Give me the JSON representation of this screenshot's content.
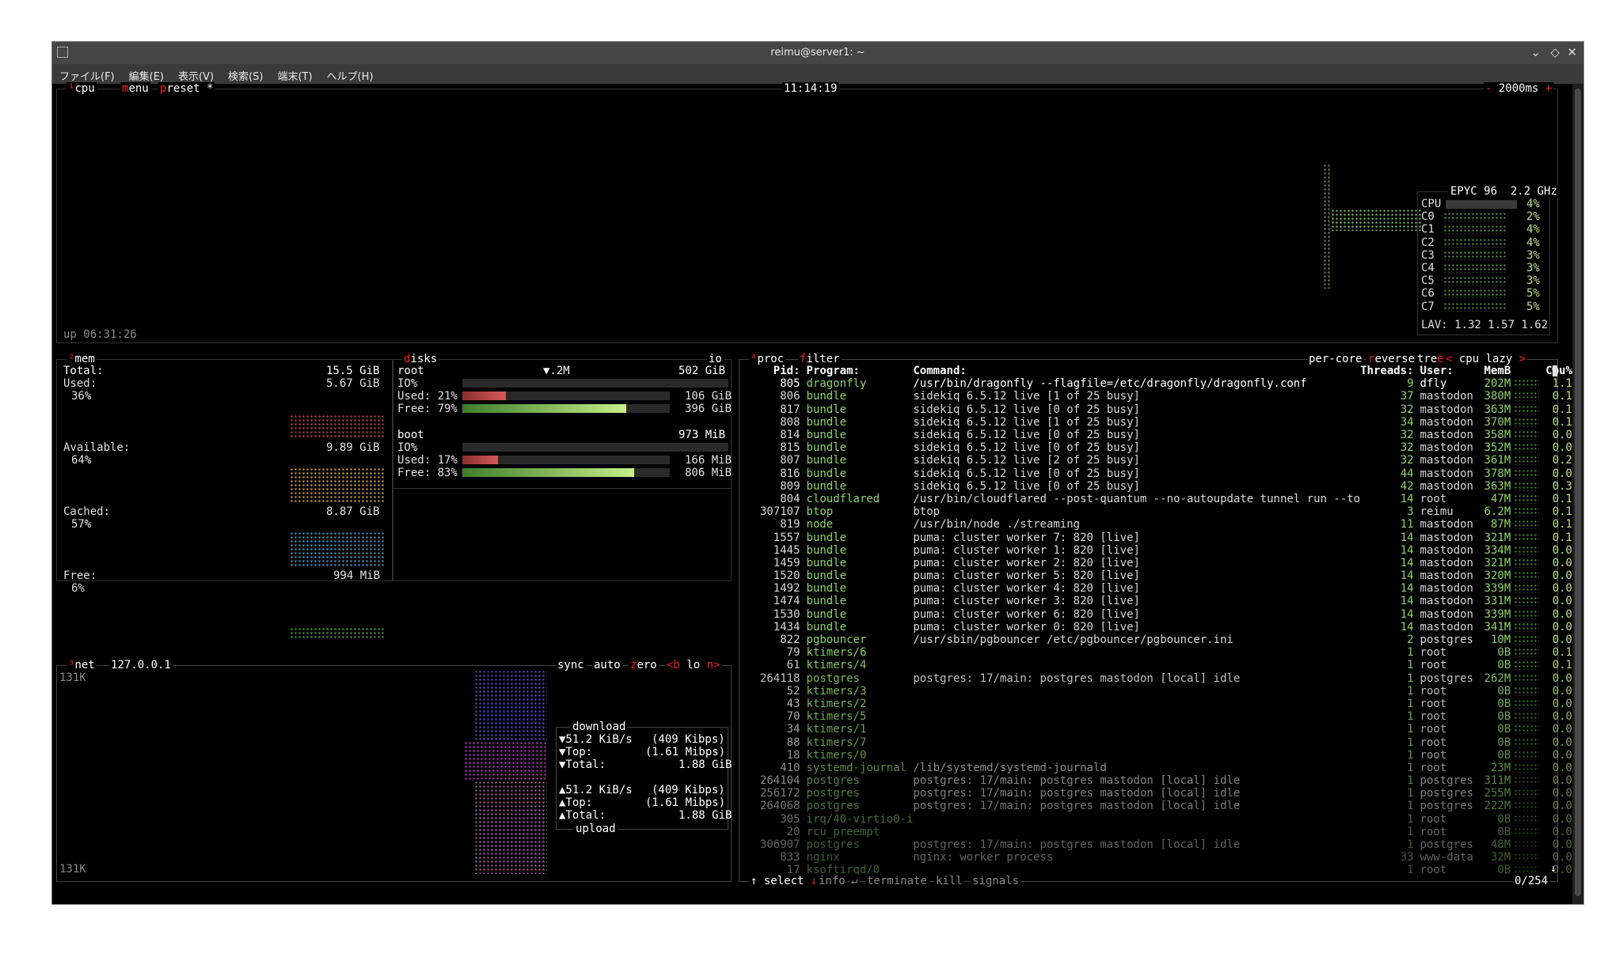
{
  "window": {
    "title": "reimu@server1: ~",
    "menu": [
      "ファイル(F)",
      "編集(E)",
      "表示(V)",
      "検索(S)",
      "端末(T)",
      "ヘルプ(H)"
    ]
  },
  "cpu_box": {
    "tab_num": "¹",
    "tab_cpu": "cpu",
    "tab_menu_m": "m",
    "tab_menu_rest": "enu",
    "tab_preset_p": "p",
    "tab_preset_rest": "reset *",
    "clock": "11:14:19",
    "interval": "2000ms",
    "plus": "+",
    "minus": "-",
    "uptime": "up 06:31:26",
    "cpu_model": "EPYC 96",
    "freq": "2.2 GHz",
    "cores": [
      {
        "label": "CPU",
        "pct": "4%"
      },
      {
        "label": "C0",
        "pct": "2%"
      },
      {
        "label": "C1",
        "pct": "4%"
      },
      {
        "label": "C2",
        "pct": "4%"
      },
      {
        "label": "C3",
        "pct": "3%"
      },
      {
        "label": "C4",
        "pct": "3%"
      },
      {
        "label": "C5",
        "pct": "3%"
      },
      {
        "label": "C6",
        "pct": "5%"
      },
      {
        "label": "C7",
        "pct": "5%"
      }
    ],
    "lav": "LAV: 1.32 1.57 1.62"
  },
  "mem_box": {
    "tab_num": "²",
    "title": "mem",
    "total_label": "Total:",
    "total": "15.5 GiB",
    "used_label": "Used:",
    "used": "5.67 GiB",
    "used_pct": "36%",
    "avail_label": "Available:",
    "avail": "9.89 GiB",
    "avail_pct": "64%",
    "cached_label": "Cached:",
    "cached": "8.87 GiB",
    "cached_pct": "57%",
    "free_label": "Free:",
    "free": "994 MiB",
    "free_pct": "6%",
    "colors": {
      "used": "#c0454f",
      "avail": "#d9a934",
      "cached": "#39a7c8",
      "free": "#5a9a3a"
    }
  },
  "disks_box": {
    "title_d": "d",
    "title_rest": "isks",
    "io_tab": "io",
    "root": {
      "name": "root",
      "io_marker": "▼.2M",
      "size": "502 GiB",
      "io_label": "IO%",
      "used_label": "Used: 21%",
      "used": "106 GiB",
      "free_label": "Free: 79%",
      "free": "396 GiB",
      "used_frac": 0.21,
      "free_frac": 0.79
    },
    "boot": {
      "name": "boot",
      "size": "973 MiB",
      "io_label": "IO%",
      "used_label": "Used: 17%",
      "used": "166 MiB",
      "free_label": "Free: 83%",
      "free": "806 MiB",
      "used_frac": 0.17,
      "free_frac": 0.83
    }
  },
  "net_box": {
    "tab_num": "³",
    "title": "net",
    "iface": "127.0.0.1",
    "tab_sync": "sync",
    "tab_auto": "auto",
    "tab_zero_z": "z",
    "tab_zero_rest": "ero",
    "tab_b": "<b",
    "tab_lo": "lo",
    "tab_n": "n>",
    "scale_top": "131K",
    "scale_bottom": "131K",
    "download_label": "download",
    "dl_rate": "▼51.2 KiB/s",
    "dl_rate_b": "(409 Kibps)",
    "dl_top_label": "▼Top:",
    "dl_top": "(1.61 Mibps)",
    "dl_total_label": "▼Total:",
    "dl_total": "1.88 GiB",
    "ul_rate": "▲51.2 KiB/s",
    "ul_rate_b": "(409 Kibps)",
    "ul_top_label": "▲Top:",
    "ul_top": "(1.61 Mibps)",
    "ul_total_label": "▲Total:",
    "ul_total": "1.88 GiB",
    "upload_label": "upload"
  },
  "proc_box": {
    "tab_num": "⁴",
    "title": "proc",
    "tab_filter_f": "f",
    "tab_filter_rest": "ilter",
    "tab_percore": "per-core",
    "tab_reverse_r": "r",
    "tab_reverse_rest": "everse",
    "tab_tree_t": "tre",
    "tab_tree_e": "e",
    "tab_sort_left": "<",
    "tab_sort": "cpu lazy",
    "tab_sort_right": ">",
    "headers": {
      "pid": "Pid:",
      "program": "Program:",
      "command": "Command:",
      "threads": "Threads:",
      "user": "User:",
      "mem": "MemB",
      "cpu": "Cpu%"
    },
    "rows": [
      {
        "pid": "805",
        "program": "dragonfly",
        "command": "/usr/bin/dragonfly --flagfile=/etc/dragonfly/dragonfly.conf",
        "threads": "9",
        "user": "dfly",
        "mem": "202M",
        "cpu": "1.1"
      },
      {
        "pid": "806",
        "program": "bundle",
        "command": "sidekiq 6.5.12 live [1 of 25 busy]",
        "threads": "37",
        "user": "mastodon",
        "mem": "380M",
        "cpu": "0.1"
      },
      {
        "pid": "817",
        "program": "bundle",
        "command": "sidekiq 6.5.12 live [0 of 25 busy]",
        "threads": "32",
        "user": "mastodon",
        "mem": "363M",
        "cpu": "0.1"
      },
      {
        "pid": "808",
        "program": "bundle",
        "command": "sidekiq 6.5.12 live [1 of 25 busy]",
        "threads": "34",
        "user": "mastodon",
        "mem": "370M",
        "cpu": "0.1"
      },
      {
        "pid": "814",
        "program": "bundle",
        "command": "sidekiq 6.5.12 live [0 of 25 busy]",
        "threads": "32",
        "user": "mastodon",
        "mem": "358M",
        "cpu": "0.0"
      },
      {
        "pid": "815",
        "program": "bundle",
        "command": "sidekiq 6.5.12 live [0 of 25 busy]",
        "threads": "32",
        "user": "mastodon",
        "mem": "352M",
        "cpu": "0.0"
      },
      {
        "pid": "807",
        "program": "bundle",
        "command": "sidekiq 6.5.12 live [2 of 25 busy]",
        "threads": "32",
        "user": "mastodon",
        "mem": "361M",
        "cpu": "0.2"
      },
      {
        "pid": "816",
        "program": "bundle",
        "command": "sidekiq 6.5.12 live [0 of 25 busy]",
        "threads": "44",
        "user": "mastodon",
        "mem": "378M",
        "cpu": "0.0"
      },
      {
        "pid": "809",
        "program": "bundle",
        "command": "sidekiq 6.5.12 live [0 of 25 busy]",
        "threads": "42",
        "user": "mastodon",
        "mem": "363M",
        "cpu": "0.3"
      },
      {
        "pid": "804",
        "program": "cloudflared",
        "command": "/usr/bin/cloudflared --post-quantum --no-autoupdate tunnel run --to",
        "threads": "14",
        "user": "root",
        "mem": "47M",
        "cpu": "0.1"
      },
      {
        "pid": "307107",
        "program": "btop",
        "command": "btop",
        "threads": "3",
        "user": "reimu",
        "mem": "6.2M",
        "cpu": "0.1"
      },
      {
        "pid": "819",
        "program": "node",
        "command": "/usr/bin/node ./streaming",
        "threads": "11",
        "user": "mastodon",
        "mem": "87M",
        "cpu": "0.1"
      },
      {
        "pid": "1557",
        "program": "bundle",
        "command": "puma: cluster worker 7: 820 [live]",
        "threads": "14",
        "user": "mastodon",
        "mem": "321M",
        "cpu": "0.1"
      },
      {
        "pid": "1445",
        "program": "bundle",
        "command": "puma: cluster worker 1: 820 [live]",
        "threads": "14",
        "user": "mastodon",
        "mem": "334M",
        "cpu": "0.0"
      },
      {
        "pid": "1459",
        "program": "bundle",
        "command": "puma: cluster worker 2: 820 [live]",
        "threads": "14",
        "user": "mastodon",
        "mem": "321M",
        "cpu": "0.0"
      },
      {
        "pid": "1520",
        "program": "bundle",
        "command": "puma: cluster worker 5: 820 [live]",
        "threads": "14",
        "user": "mastodon",
        "mem": "320M",
        "cpu": "0.0"
      },
      {
        "pid": "1492",
        "program": "bundle",
        "command": "puma: cluster worker 4: 820 [live]",
        "threads": "14",
        "user": "mastodon",
        "mem": "339M",
        "cpu": "0.0"
      },
      {
        "pid": "1474",
        "program": "bundle",
        "command": "puma: cluster worker 3: 820 [live]",
        "threads": "14",
        "user": "mastodon",
        "mem": "331M",
        "cpu": "0.0"
      },
      {
        "pid": "1530",
        "program": "bundle",
        "command": "puma: cluster worker 6: 820 [live]",
        "threads": "14",
        "user": "mastodon",
        "mem": "339M",
        "cpu": "0.0"
      },
      {
        "pid": "1434",
        "program": "bundle",
        "command": "puma: cluster worker 0: 820 [live]",
        "threads": "14",
        "user": "mastodon",
        "mem": "341M",
        "cpu": "0.0"
      },
      {
        "pid": "822",
        "program": "pgbouncer",
        "command": "/usr/sbin/pgbouncer /etc/pgbouncer/pgbouncer.ini",
        "threads": "2",
        "user": "postgres",
        "mem": "10M",
        "cpu": "0.0"
      },
      {
        "pid": "79",
        "program": "ktimers/6",
        "command": "",
        "threads": "1",
        "user": "root",
        "mem": "0B",
        "cpu": "0.1"
      },
      {
        "pid": "61",
        "program": "ktimers/4",
        "command": "",
        "threads": "1",
        "user": "root",
        "mem": "0B",
        "cpu": "0.1"
      },
      {
        "pid": "264118",
        "program": "postgres",
        "command": "postgres: 17/main: postgres mastodon [local] idle",
        "threads": "1",
        "user": "postgres",
        "mem": "262M",
        "cpu": "0.0"
      },
      {
        "pid": "52",
        "program": "ktimers/3",
        "command": "",
        "threads": "1",
        "user": "root",
        "mem": "0B",
        "cpu": "0.0"
      },
      {
        "pid": "43",
        "program": "ktimers/2",
        "command": "",
        "threads": "1",
        "user": "root",
        "mem": "0B",
        "cpu": "0.0"
      },
      {
        "pid": "70",
        "program": "ktimers/5",
        "command": "",
        "threads": "1",
        "user": "root",
        "mem": "0B",
        "cpu": "0.0"
      },
      {
        "pid": "34",
        "program": "ktimers/1",
        "command": "",
        "threads": "1",
        "user": "root",
        "mem": "0B",
        "cpu": "0.0"
      },
      {
        "pid": "88",
        "program": "ktimers/7",
        "command": "",
        "threads": "1",
        "user": "root",
        "mem": "0B",
        "cpu": "0.0"
      },
      {
        "pid": "18",
        "program": "ktimers/0",
        "command": "",
        "threads": "1",
        "user": "root",
        "mem": "0B",
        "cpu": "0.0"
      },
      {
        "pid": "410",
        "program": "systemd-journal",
        "command": "/lib/systemd/systemd-journald",
        "threads": "1",
        "user": "root",
        "mem": "23M",
        "cpu": "0.0"
      },
      {
        "pid": "264104",
        "program": "postgres",
        "command": "postgres: 17/main: postgres mastodon [local] idle",
        "threads": "1",
        "user": "postgres",
        "mem": "311M",
        "cpu": "0.0"
      },
      {
        "pid": "256172",
        "program": "postgres",
        "command": "postgres: 17/main: postgres mastodon [local] idle",
        "threads": "1",
        "user": "postgres",
        "mem": "255M",
        "cpu": "0.0"
      },
      {
        "pid": "264068",
        "program": "postgres",
        "command": "postgres: 17/main: postgres mastodon [local] idle",
        "threads": "1",
        "user": "postgres",
        "mem": "222M",
        "cpu": "0.0"
      },
      {
        "pid": "305",
        "program": "irq/40-virtio0-i",
        "command": "",
        "threads": "1",
        "user": "root",
        "mem": "0B",
        "cpu": "0.0"
      },
      {
        "pid": "20",
        "program": "rcu_preempt",
        "command": "",
        "threads": "1",
        "user": "root",
        "mem": "0B",
        "cpu": "0.0"
      },
      {
        "pid": "306907",
        "program": "postgres",
        "command": "postgres: 17/main: postgres mastodon [local] idle",
        "threads": "1",
        "user": "postgres",
        "mem": "48M",
        "cpu": "0.0"
      },
      {
        "pid": "833",
        "program": "nginx",
        "command": "nginx: worker process",
        "threads": "33",
        "user": "www-data",
        "mem": "32M",
        "cpu": "0.0"
      },
      {
        "pid": "17",
        "program": "ksoftirqd/0",
        "command": "",
        "threads": "1",
        "user": "root",
        "mem": "0B",
        "cpu": "0.0"
      }
    ],
    "footer": {
      "select_arrow": "↑",
      "select": "select",
      "down_arrow": "↓",
      "info": "info",
      "enter": "↵",
      "terminate": "terminate",
      "kill": "kill",
      "signals": "signals",
      "count": "0/254"
    }
  }
}
